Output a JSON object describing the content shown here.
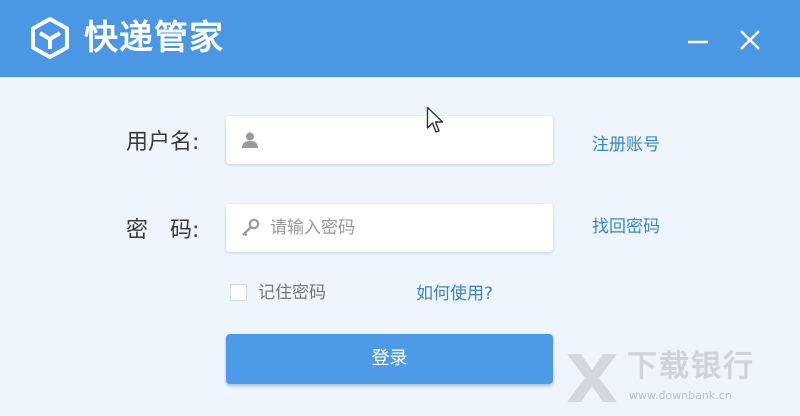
{
  "window": {
    "title": "快递管家",
    "logo_icon": "cube-logo-icon",
    "controls": {
      "minimize_icon": "minimize-icon",
      "close_icon": "close-icon"
    }
  },
  "login_form": {
    "username": {
      "label": "用户名:",
      "icon": "user-icon",
      "value": "",
      "placeholder": ""
    },
    "password": {
      "label": "密　码:",
      "icon": "key-icon",
      "value": "",
      "placeholder": "请输入密码"
    },
    "links": {
      "register": "注册账号",
      "forgot_password": "找回密码",
      "help": "如何使用?"
    },
    "remember": {
      "label": "记住密码",
      "checked": false
    },
    "submit_label": "登录"
  },
  "watermark": {
    "name": "下载银行",
    "url": "www.downbank.cn"
  },
  "colors": {
    "titlebar": "#4a97e4",
    "background": "#eef5fd",
    "link": "#3787cc",
    "button": "#4d9be6"
  }
}
